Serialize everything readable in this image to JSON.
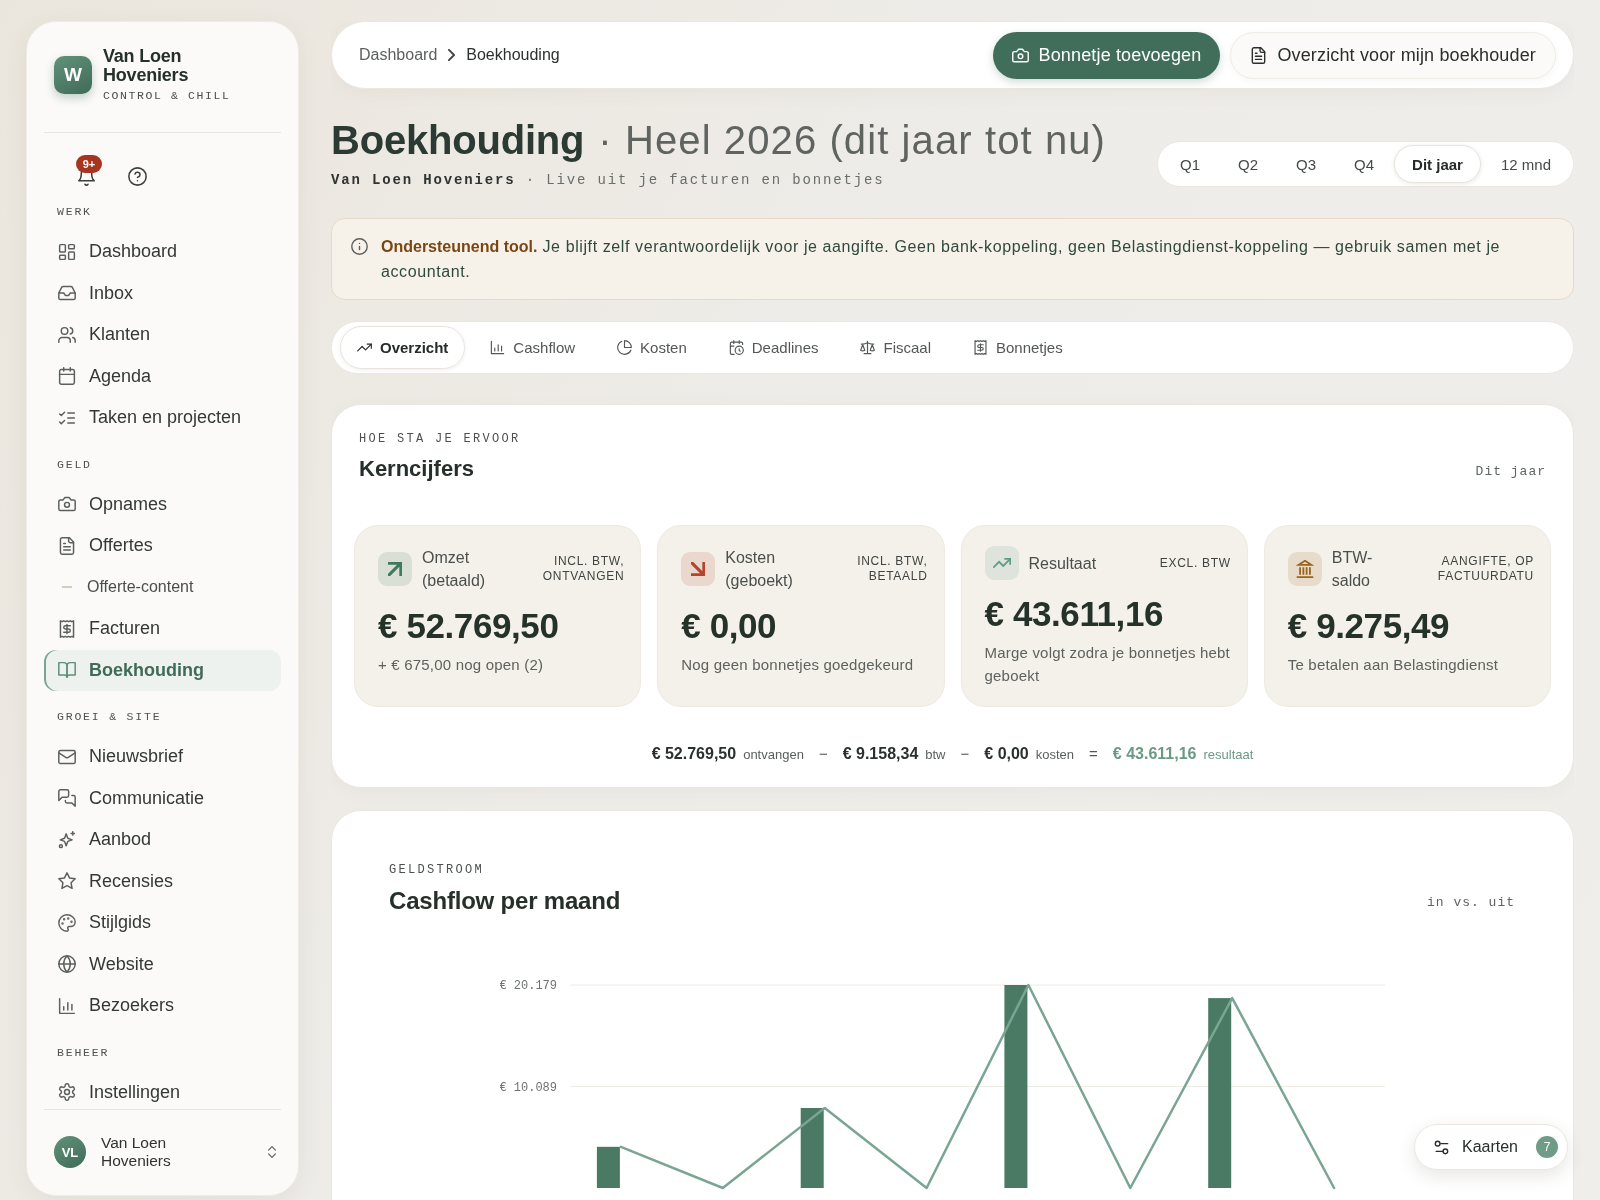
{
  "sidebar": {
    "brand": {
      "logo": "W",
      "name": "Van Loen Hoveniers",
      "tagline": "CONTROL & CHILL"
    },
    "notifications": {
      "badge": "9+"
    },
    "sections": [
      {
        "title": "WERK",
        "items": [
          {
            "label": "Dashboard",
            "kind": "link",
            "selected": false
          },
          {
            "label": "Inbox",
            "kind": "link",
            "selected": false
          },
          {
            "label": "Klanten",
            "kind": "link",
            "selected": false
          },
          {
            "label": "Agenda",
            "kind": "link",
            "selected": false
          },
          {
            "label": "Taken en projecten",
            "kind": "link",
            "selected": false
          }
        ]
      },
      {
        "title": "GELD",
        "items": [
          {
            "label": "Opnames",
            "kind": "link",
            "selected": false
          },
          {
            "label": "Offertes",
            "kind": "link",
            "selected": false
          },
          {
            "label": "Offerte-content",
            "kind": "sub",
            "selected": false
          },
          {
            "label": "Facturen",
            "kind": "link",
            "selected": false
          },
          {
            "label": "Boekhouding",
            "kind": "link",
            "selected": true
          }
        ]
      },
      {
        "title": "GROEI & SITE",
        "items": [
          {
            "label": "Nieuwsbrief",
            "kind": "link",
            "selected": false
          },
          {
            "label": "Communicatie",
            "kind": "link",
            "selected": false
          },
          {
            "label": "Aanbod",
            "kind": "link",
            "selected": false
          },
          {
            "label": "Recensies",
            "kind": "link",
            "selected": false
          },
          {
            "label": "Stijlgids",
            "kind": "link",
            "selected": false
          },
          {
            "label": "Website",
            "kind": "link",
            "selected": false
          },
          {
            "label": "Bezoekers",
            "kind": "link",
            "selected": false
          }
        ]
      },
      {
        "title": "BEHEER",
        "items": [
          {
            "label": "Instellingen",
            "kind": "link",
            "selected": false
          }
        ]
      }
    ],
    "user": {
      "initials": "VL",
      "name": "Van Loen Hoveniers"
    }
  },
  "topbar": {
    "breadcrumb": [
      {
        "label": "Dashboard",
        "current": false
      },
      {
        "label": "Boekhouding",
        "current": true
      }
    ],
    "buttons": [
      {
        "label": "Bonnetje toevoegen",
        "kind": "primary"
      },
      {
        "label": "Overzicht voor mijn boekhouder",
        "kind": "secondary"
      }
    ]
  },
  "header": {
    "title": "Boekhouding",
    "period_label": "· Heel 2026 (dit jaar tot nu)",
    "subtitle": "**Van Loen Hoveniers** · Live uit je facturen en bonnetjes",
    "periods": [
      {
        "label": "Q1",
        "selected": false
      },
      {
        "label": "Q2",
        "selected": false
      },
      {
        "label": "Q3",
        "selected": false
      },
      {
        "label": "Q4",
        "selected": false
      },
      {
        "label": "Dit jaar",
        "selected": true
      },
      {
        "label": "12 mnd",
        "selected": false
      }
    ]
  },
  "notice": {
    "text": "**Ondersteunend tool.** Je blijft zelf verantwoordelijk voor je aangifte. Geen bank-koppeling, geen Belastingdienst-koppeling — gebruik samen met je accountant."
  },
  "tabs": [
    {
      "label": "Overzicht",
      "selected": true
    },
    {
      "label": "Cashflow",
      "selected": false
    },
    {
      "label": "Kosten",
      "selected": false
    },
    {
      "label": "Deadlines",
      "selected": false
    },
    {
      "label": "Fiscaal",
      "selected": false
    },
    {
      "label": "Bonnetjes",
      "selected": false
    }
  ],
  "kpi_panel": {
    "eyebrow": "HOE STA JE ERVOOR",
    "title": "Kerncijfers",
    "scope": "Dit jaar",
    "cards": [
      {
        "label": "Omzet (betaald)",
        "tag": "INCL. BTW, ONTVANGEN",
        "value": "€ 52.769,50",
        "note": "+ € 675,00 nog open (2)",
        "color": "#3e7a5d"
      },
      {
        "label": "Kosten (geboekt)",
        "tag": "INCL. BTW, BETAALD",
        "value": "€ 0,00",
        "note": "Nog geen bonnetjes goedgekeurd",
        "color": "#b2452c"
      },
      {
        "label": "Resultaat",
        "tag": "EXCL. BTW",
        "value": "€ 43.611,16",
        "note": "Marge volgt zodra je bonnetjes hebt geboekt",
        "color": "#5f9a84"
      },
      {
        "label": "BTW-saldo",
        "tag": "AANGIFTE, OP FACTUURDATU",
        "value": "€ 9.275,49",
        "note": "Te betalen aan Belastingdienst",
        "color": "#9b6419"
      }
    ],
    "equation": {
      "terms": [
        {
          "amount": "€ 52.769,50",
          "label": "ontvangen",
          "highlighted": false
        },
        {
          "amount": "€ 9.158,34",
          "label": "btw",
          "highlighted": false
        },
        {
          "amount": "€ 0,00",
          "label": "kosten",
          "highlighted": false
        },
        {
          "amount": "€ 43.611,16",
          "label": "resultaat",
          "highlighted": true
        }
      ],
      "operators": [
        "−",
        "−",
        "="
      ]
    }
  },
  "cashflow": {
    "eyebrow": "GELDSTROOM",
    "title": "Cashflow per maand",
    "scope": "in vs. uit",
    "chart_data": {
      "type": "bar",
      "ylim": [
        0,
        20179
      ],
      "yticks": [
        {
          "value": 20179,
          "label": "€ 20.179"
        },
        {
          "value": 10089,
          "label": "€ 10.089"
        }
      ],
      "series": [
        {
          "type": "bar",
          "color": "#4a7a64",
          "values": [
            4100,
            0,
            7950,
            0,
            20179,
            0,
            18880,
            0
          ]
        },
        {
          "type": "line",
          "color": "#7aa593",
          "values": [
            4100,
            0,
            7950,
            0,
            20179,
            0,
            18880,
            0
          ]
        }
      ]
    }
  },
  "cards_button": {
    "label": "Kaarten",
    "count": "7"
  }
}
